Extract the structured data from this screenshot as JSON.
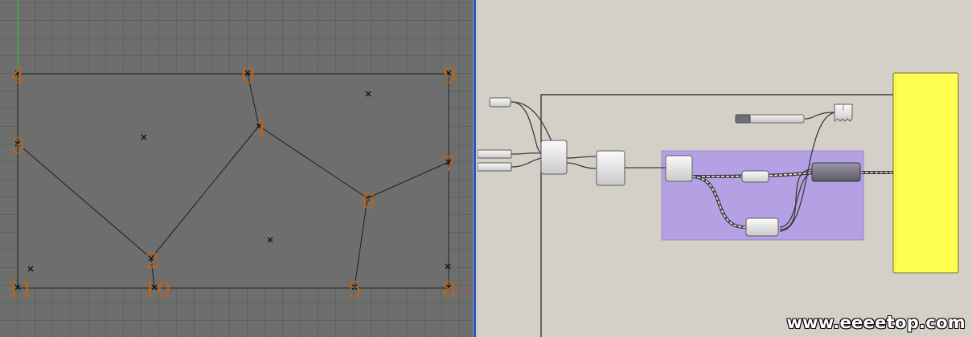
{
  "viewport": {
    "points": [
      {
        "label": "4"
      },
      {
        "label": "0"
      },
      {
        "label": "9"
      },
      {
        "label": "3"
      },
      {
        "label": "1"
      },
      {
        "label": "7"
      },
      {
        "label": "6"
      },
      {
        "label": "2"
      },
      {
        "label": "11"
      },
      {
        "label": "10"
      },
      {
        "label": "5"
      },
      {
        "label": "8"
      }
    ]
  },
  "canvas": {
    "group_color": "#b09ae6",
    "panel_color": "#ffff52"
  },
  "watermark": "www.eeeetop.com"
}
